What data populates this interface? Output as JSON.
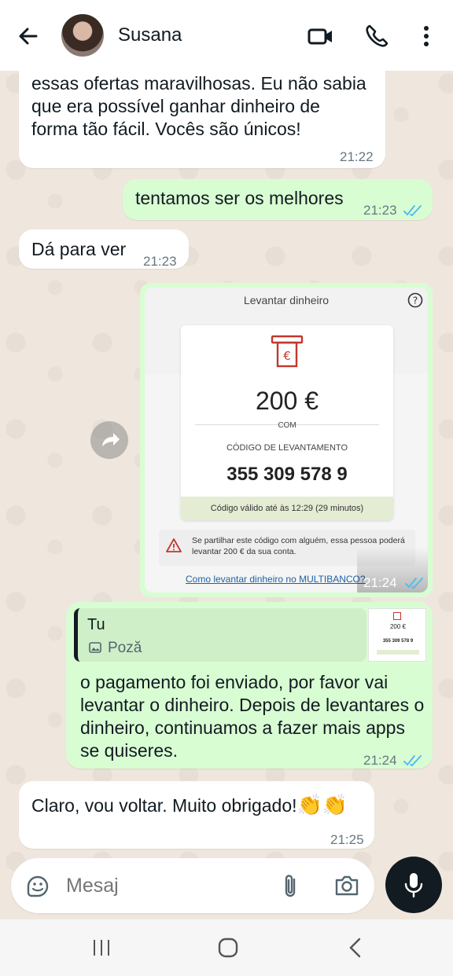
{
  "header": {
    "contact_name": "Susana"
  },
  "messages": [
    {
      "id": "m1",
      "direction": "in",
      "text": "essas ofertas maravilhosas. Eu não sabia que era possível ganhar dinheiro de forma tão fácil. Vocês são únicos!",
      "time": "21:22"
    },
    {
      "id": "m2",
      "direction": "out",
      "text": "tentamos ser os melhores",
      "time": "21:23",
      "status": "read"
    },
    {
      "id": "m3",
      "direction": "in",
      "text": "Dá para ver",
      "time": "21:23"
    },
    {
      "id": "m4",
      "direction": "out",
      "type": "image",
      "time": "21:24",
      "status": "read",
      "image": {
        "title": "Levantar dinheiro",
        "amount": "200 €",
        "amount_sub": "COM",
        "code_label": "CÓDIGO DE LEVANTAMENTO",
        "code": "355 309 578 9",
        "validity": "Código válido até às 12:29 (29 minutos)",
        "warning": "Se partilhar este código com alguém, essa pessoa poderá levantar 200 € da sua conta.",
        "link": "Como levantar dinheiro no MULTIBANCO?"
      }
    },
    {
      "id": "m5",
      "direction": "out",
      "reply_to": {
        "author": "Tu",
        "media_label": "Poză",
        "thumb_amount": "200 €",
        "thumb_code": "355 309 578 9"
      },
      "text": "o pagamento foi enviado, por favor vai levantar o dinheiro. Depois de levantares o dinheiro, continuamos a fazer mais apps se quiseres.",
      "time": "21:24",
      "status": "read"
    },
    {
      "id": "m6",
      "direction": "in",
      "text": "Claro, vou voltar. Muito obrigado!",
      "emoji": "👏👏",
      "time": "21:25"
    }
  ],
  "input": {
    "placeholder": "Mesaj"
  },
  "colors": {
    "incoming": "#ffffff",
    "outgoing": "#d9fdd3",
    "tick_read": "#53bdeb",
    "link": "#1f5fa8",
    "warning_red": "#c0392b"
  },
  "icons": [
    "back-arrow-icon",
    "video-call-icon",
    "phone-icon",
    "more-vert-icon",
    "forward-icon",
    "read-ticks-icon",
    "image-icon",
    "sticker-icon",
    "attach-icon",
    "camera-icon",
    "mic-icon",
    "recents-icon",
    "home-icon",
    "back-nav-icon",
    "atm-icon",
    "help-icon",
    "warning-icon"
  ]
}
